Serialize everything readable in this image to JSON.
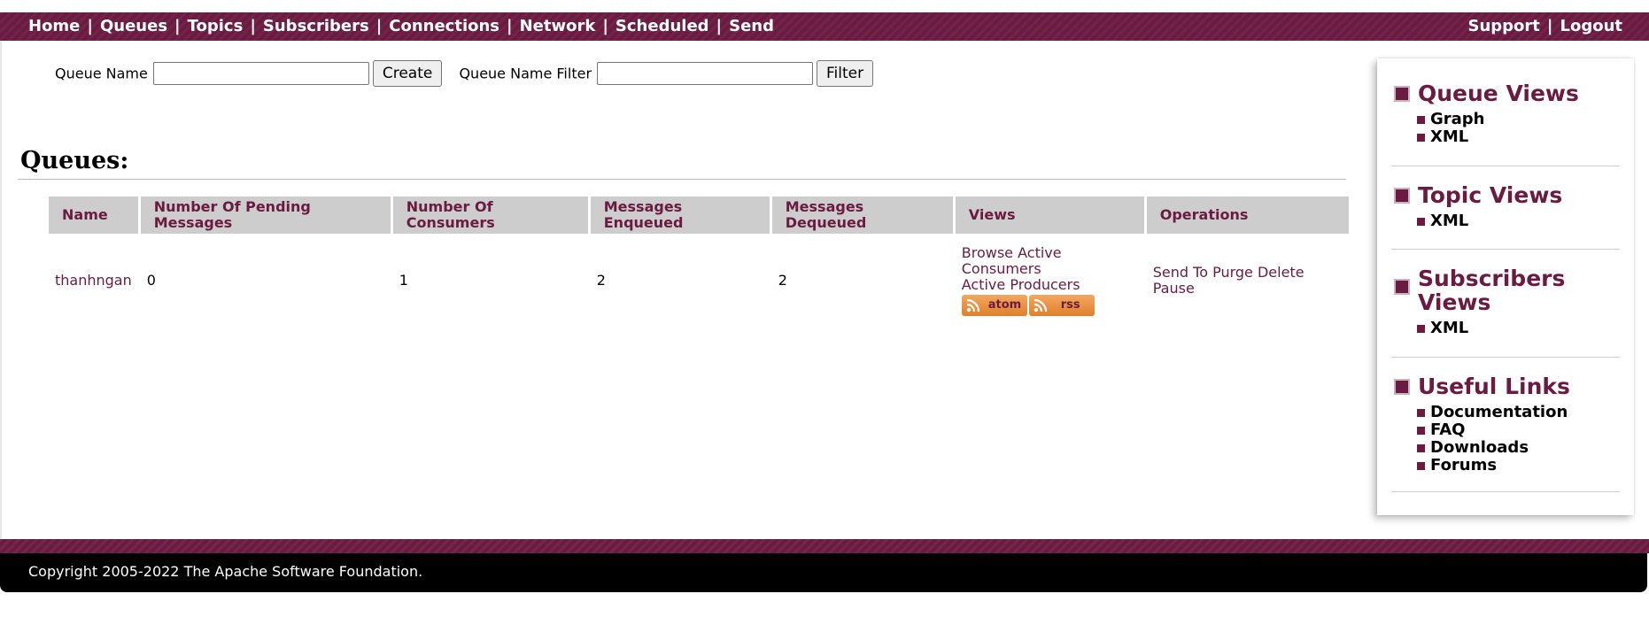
{
  "nav": {
    "left": [
      "Home",
      "Queues",
      "Topics",
      "Subscribers",
      "Connections",
      "Network",
      "Scheduled",
      "Send"
    ],
    "right": [
      "Support",
      "Logout"
    ]
  },
  "forms": {
    "queue_name_label": "Queue Name",
    "queue_name_value": "",
    "create_label": "Create",
    "filter_label": "Queue Name Filter",
    "filter_value": "",
    "filter_button": "Filter"
  },
  "queues": {
    "heading": "Queues:",
    "columns": [
      "Name",
      "Number Of Pending Messages",
      "Number Of Consumers",
      "Messages Enqueued",
      "Messages Dequeued",
      "Views",
      "Operations"
    ],
    "rows": [
      {
        "name": "thanhngan",
        "pending": "0",
        "consumers": "1",
        "enqueued": "2",
        "dequeued": "2",
        "browse": "Browse",
        "active_consumers": "Active Consumers",
        "active_producers": "Active Producers",
        "atom": "atom",
        "rss": "rss",
        "send_to": "Send To",
        "purge": "Purge",
        "delete": "Delete",
        "pause": "Pause"
      }
    ]
  },
  "sidebar": {
    "sections": [
      {
        "title": "Queue Views",
        "links": [
          "Graph",
          "XML"
        ]
      },
      {
        "title": "Topic Views",
        "links": [
          "XML"
        ]
      },
      {
        "title": "Subscribers Views",
        "links": [
          "XML"
        ]
      },
      {
        "title": "Useful Links",
        "links": [
          "Documentation",
          "FAQ",
          "Downloads",
          "Forums"
        ]
      }
    ]
  },
  "footer": {
    "copyright": "Copyright 2005-2022 The Apache Software Foundation."
  },
  "colors": {
    "brand": "#6b1b41",
    "header_cell": "#cdcdcd",
    "footer_bg": "#000000",
    "feed_orange": "#e88f3d"
  }
}
